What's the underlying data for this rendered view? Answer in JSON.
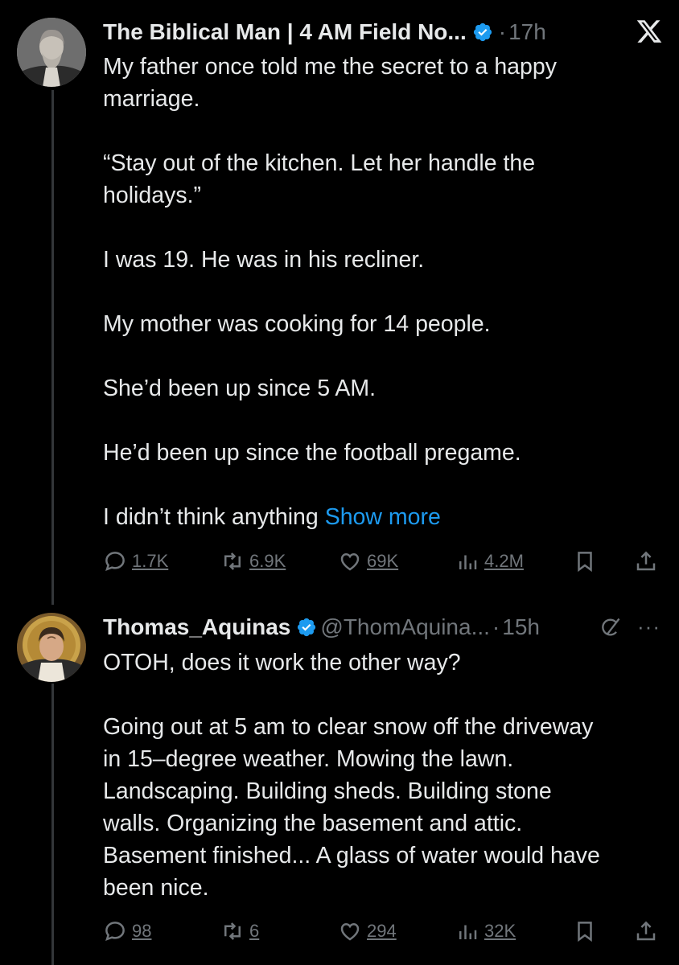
{
  "tweets": [
    {
      "name": "The Biblical Man | 4 AM Field No...",
      "handle": "",
      "time": "17h",
      "lines": [
        "My father once told me the secret to a happy",
        "marriage.",
        "",
        "“Stay out of the kitchen. Let her handle the",
        "holidays.”",
        "",
        "I was 19. He was in his recliner.",
        "",
        "My mother was cooking for 14 people.",
        "",
        "She’d been up since 5 AM.",
        "",
        "He’d been up since the football pregame.",
        "",
        "I didn’t think anything"
      ],
      "show_more": "Show more",
      "replies": "1.7K",
      "retweets": "6.9K",
      "likes": "69K",
      "views": "4.2M"
    },
    {
      "name": "Thomas_Aquinas",
      "handle": "@ThomAquina...",
      "time": "15h",
      "lines": [
        "OTOH, does it work the other way?",
        "",
        "Going out at 5 am to clear snow off the driveway",
        "in 15–degree weather. Mowing the lawn.",
        "Landscaping. Building sheds. Building stone",
        "walls. Organizing the basement and attic.",
        "Basement finished... A glass of water would have",
        "been nice."
      ],
      "replies": "98",
      "retweets": "6",
      "likes": "294",
      "views": "32K"
    }
  ],
  "separator_dot": "·",
  "more_dots": "···",
  "colors": {
    "accent": "#1d9bf0",
    "muted": "#71767b",
    "text": "#e7e9ea",
    "background": "#000000"
  },
  "icons": [
    "x-logo-icon",
    "verified-badge-icon",
    "reply-icon",
    "retweet-icon",
    "like-icon",
    "views-icon",
    "bookmark-icon",
    "share-icon",
    "grok-icon",
    "more-icon"
  ]
}
